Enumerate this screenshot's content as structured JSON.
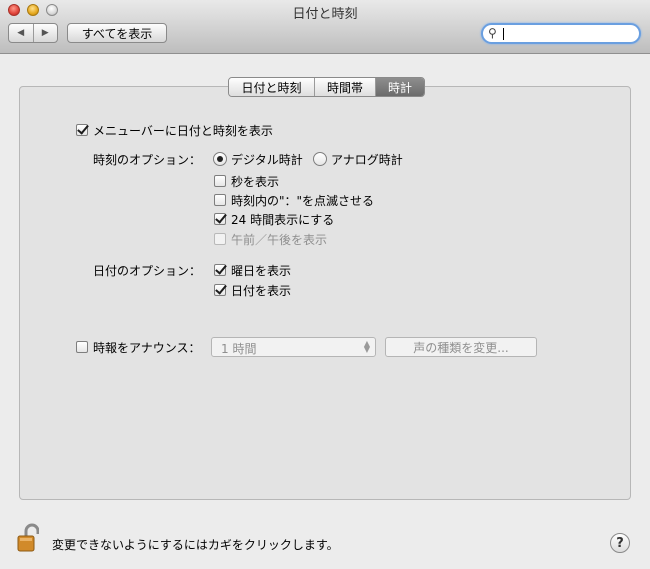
{
  "window": {
    "title": "日付と時刻"
  },
  "toolbar": {
    "back_icon": "◀",
    "forward_icon": "▶",
    "show_all_label": "すべてを表示",
    "search_value": ""
  },
  "tabs": [
    {
      "label": "日付と時刻",
      "selected": false
    },
    {
      "label": "時間帯",
      "selected": false
    },
    {
      "label": "時計",
      "selected": true
    }
  ],
  "clock": {
    "show_in_menubar": {
      "label": "メニューバーに日付と時刻を表示",
      "checked": true
    },
    "time_options_label": "時刻のオプション：",
    "digital_label": "デジタル時計",
    "analog_label": "アナログ時計",
    "selected_style": "digital",
    "show_seconds": {
      "label": "秒を表示",
      "checked": false
    },
    "flash_separators": {
      "label": "時刻内の\"：\"を点滅させる",
      "checked": false
    },
    "use_24_hour": {
      "label": "24 時間表示にする",
      "checked": true
    },
    "show_ampm": {
      "label": "午前／午後を表示",
      "checked": false,
      "enabled": false
    },
    "date_options_label": "日付のオプション：",
    "show_weekday": {
      "label": "曜日を表示",
      "checked": true
    },
    "show_date": {
      "label": "日付を表示",
      "checked": true
    },
    "announce": {
      "label": "時報をアナウンス：",
      "checked": false,
      "interval": "1 時間",
      "voice_button": "声の種類を変更..."
    }
  },
  "footer": {
    "lock_text": "変更できないようにするにはカギをクリックします。",
    "help_label": "?"
  }
}
